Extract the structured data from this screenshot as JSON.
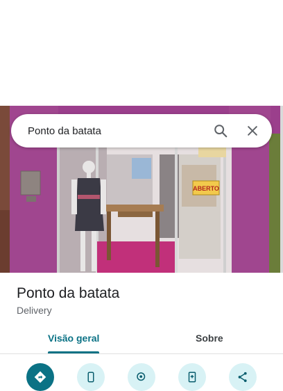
{
  "search": {
    "query": "Ponto da batata"
  },
  "place": {
    "name": "Ponto da batata",
    "category": "Delivery"
  },
  "tabs": [
    {
      "label": "Visão geral",
      "selected": true
    },
    {
      "label": "Sobre",
      "selected": false
    }
  ],
  "photo": {
    "sign_text": "ABERTO"
  },
  "actions": [
    {
      "icon": "directions-icon"
    },
    {
      "icon": "phone-icon"
    },
    {
      "icon": "location-search-icon"
    },
    {
      "icon": "save-icon"
    },
    {
      "icon": "share-icon"
    }
  ],
  "colors": {
    "accent": "#0b7285",
    "action_bg": "#d8f2f5",
    "wall": "#9b3f8c"
  }
}
